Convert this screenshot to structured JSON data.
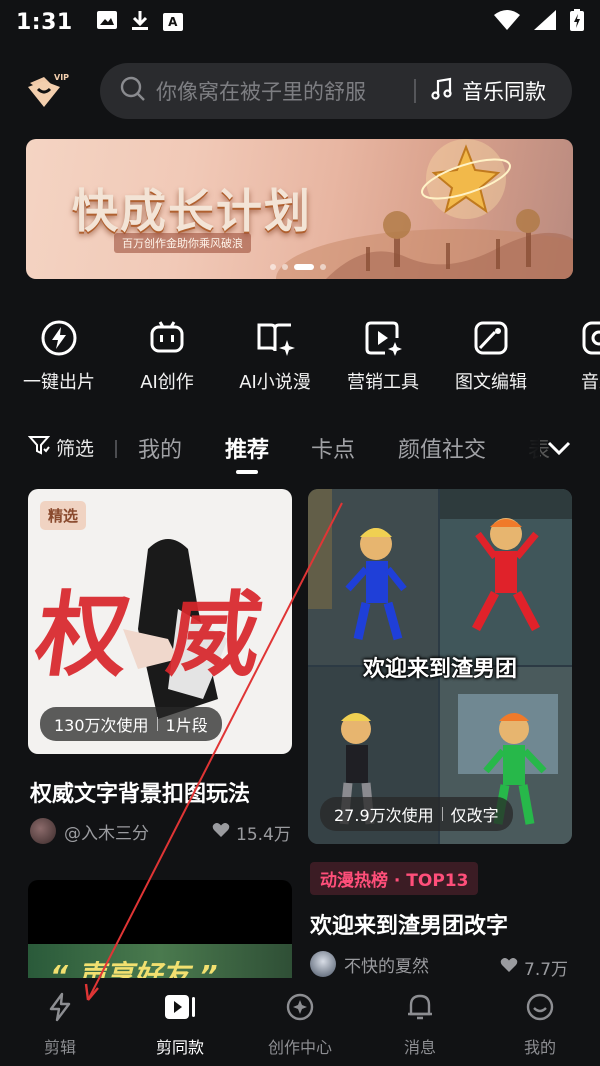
{
  "status_bar": {
    "time": "1:31",
    "a_icon_label": "A"
  },
  "header": {
    "search_placeholder": "你像窝在被子里的舒服",
    "music_label": "音乐同款",
    "vip_label": "VIP"
  },
  "banner": {
    "title": "快成长计划",
    "subtitle": "百万创作金助你乘风破浪",
    "page_dots": 4,
    "active_dot": 3
  },
  "tools": [
    {
      "label": "一键出片",
      "icon": "bolt-circle-icon"
    },
    {
      "label": "AI创作",
      "icon": "robot-icon"
    },
    {
      "label": "AI小说漫",
      "icon": "book-sparkle-icon"
    },
    {
      "label": "营销工具",
      "icon": "play-sparkle-icon"
    },
    {
      "label": "图文编辑",
      "icon": "image-edit-icon"
    },
    {
      "label": "音乐",
      "icon": "music-circle-icon"
    }
  ],
  "tabs": {
    "filter_label": "筛选",
    "items": [
      "我的",
      "推荐",
      "卡点",
      "颜值社交",
      "表"
    ],
    "active_index": 1
  },
  "cards": [
    {
      "badge": "精选",
      "art_text": "权威",
      "usage": "130万次使用",
      "segments": "1片段",
      "title": "权威文字背景扣图玩法",
      "author": "@入木三分",
      "likes": "15.4万"
    },
    {
      "overlay_text": "欢迎来到渣男团",
      "usage": "27.9万次使用",
      "tag": "仅改字",
      "hot_badge": "动漫热榜 · TOP13",
      "title": "欢迎来到渣男团改字",
      "author": "不快的夏然",
      "likes": "7.7万"
    },
    {
      "art_text": "“ 声享好友 ”"
    }
  ],
  "bottom_nav": [
    {
      "label": "剪辑",
      "icon": "lightning-icon"
    },
    {
      "label": "剪同款",
      "icon": "clip-template-icon"
    },
    {
      "label": "创作中心",
      "icon": "creator-center-icon"
    },
    {
      "label": "消息",
      "icon": "bell-icon"
    },
    {
      "label": "我的",
      "icon": "profile-smile-icon"
    }
  ],
  "bottom_nav_active": 1,
  "colors": {
    "background": "#111214",
    "search_bg": "#2a2b2e",
    "hot_badge": "#ff4f7a",
    "annotation_arrow": "#e03535"
  }
}
